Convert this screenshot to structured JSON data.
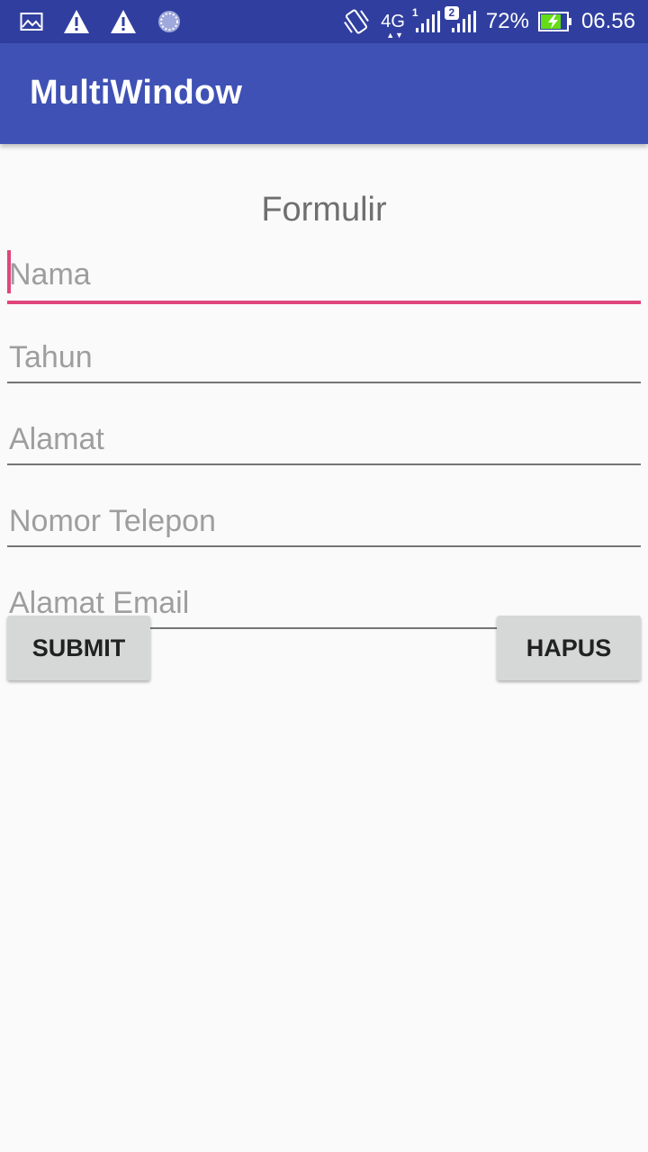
{
  "status_bar": {
    "network_sim1_index": "1",
    "network_sim2_index": "2",
    "network_type": "4G",
    "battery_percent": "72%",
    "time": "06.56",
    "icons": [
      "image-icon",
      "warning-icon",
      "warning-icon",
      "loading-icon",
      "vibrate-icon",
      "signal-icon",
      "signal-icon",
      "battery-charging-icon"
    ]
  },
  "app_bar": {
    "title": "MultiWindow"
  },
  "form": {
    "title": "Formulir",
    "fields": [
      {
        "hint": "Nama"
      },
      {
        "hint": "Tahun"
      },
      {
        "hint": "Alamat"
      },
      {
        "hint": "Nomor Telepon"
      },
      {
        "hint": "Alamat Email"
      }
    ],
    "submit_label": "SUBMIT",
    "clear_label": "HAPUS"
  },
  "colors": {
    "status_bar": "#303f9f",
    "app_bar": "#3f51b5",
    "accent": "#e0457b",
    "background": "#fafafa",
    "button": "#d6d7d7"
  }
}
